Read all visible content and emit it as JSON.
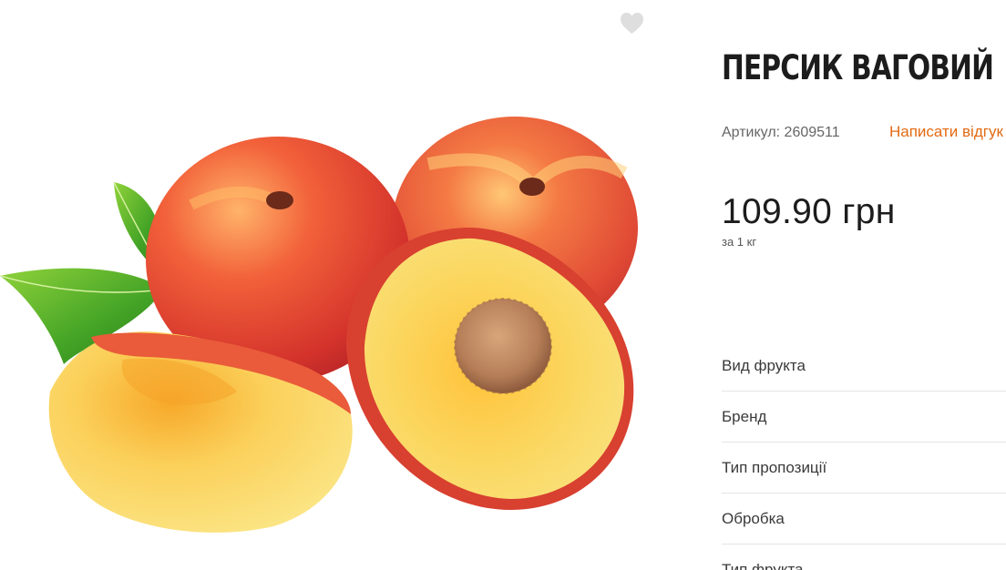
{
  "product": {
    "title": "ПЕРСИК ВАГОВИЙ",
    "sku_text": "Артикул: 2609511",
    "review_link": "Написати відгук",
    "price": "109.90 грн",
    "unit": "за 1 кг",
    "image_alt": "Персик ваговий",
    "wishlist_icon": "heart-icon",
    "accent_color": "#e36a13"
  },
  "attributes": [
    {
      "label": "Вид фрукта"
    },
    {
      "label": "Бренд"
    },
    {
      "label": "Тип пропозиції"
    },
    {
      "label": "Обробка"
    },
    {
      "label": "Тип фрукта"
    }
  ]
}
